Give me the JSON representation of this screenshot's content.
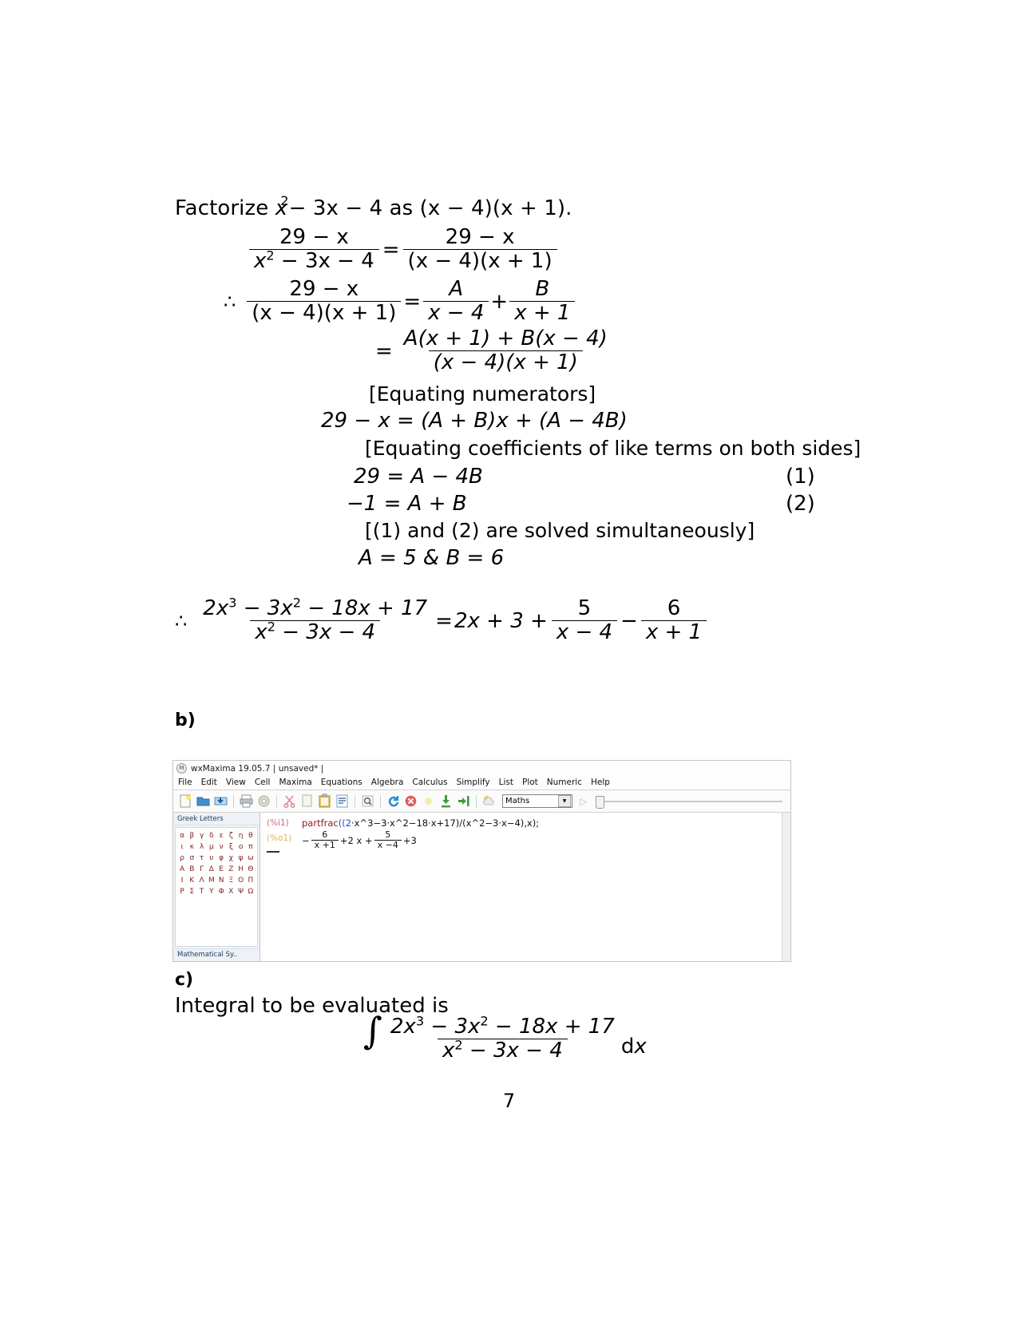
{
  "document": {
    "page_number": "7",
    "intro_line": {
      "prefix": "Factorize ",
      "expr_x": "x",
      "expr_sup": "2",
      "rest": "− 3x − 4 as (x − 4)(x + 1)."
    },
    "equations": {
      "eq1": {
        "lhs_num": "29 − x",
        "lhs_den_a": "x",
        "lhs_den_sup": "2",
        "lhs_den_b": " − 3x − 4",
        "rel": "=",
        "rhs_num": "29 − x",
        "rhs_den": "(x − 4)(x + 1)"
      },
      "eq2": {
        "therefore": "∴",
        "lhs_num": "29 − x",
        "lhs_den": "(x − 4)(x + 1)",
        "rel": "=",
        "t1_num": "A",
        "t1_den": "x − 4",
        "plus": "+",
        "t2_num": "B",
        "t2_den": "x + 1"
      },
      "eq3": {
        "rel": "=",
        "num": "A(x + 1) + B(x − 4)",
        "den": "(x − 4)(x + 1)"
      },
      "bracket1": "[Equating numerators]",
      "eq4": "29 − x = (A + B)x + (A − 4B)",
      "bracket2": "[Equating coefficients of like terms on both sides]",
      "eq5": "29 = A − 4B",
      "tag1": "(1)",
      "eq6": "−1 = A + B",
      "tag2": "(2)",
      "bracket3": "[(1) and (2) are solved simultaneously]",
      "eq7": "A = 5 & B = 6",
      "final": {
        "therefore": "∴",
        "num_a": "2x",
        "num_sup1": "3",
        "num_b": " − 3x",
        "num_sup2": "2",
        "num_c": " − 18x + 17",
        "den_a": "x",
        "den_sup": "2",
        "den_b": " − 3x − 4",
        "rel": "=",
        "poly": "2x + 3 +",
        "t1_num": "5",
        "t1_den": "x − 4",
        "minus": "−",
        "t2_num": "6",
        "t2_den": "x + 1"
      }
    },
    "part_b_label": "b)",
    "part_c_label": "c)",
    "part_c_intro": "Integral to be evaluated is",
    "integral": {
      "symbol": "∫",
      "num_a": "2x",
      "num_sup1": "3",
      "num_b": " − 3x",
      "num_sup2": "2",
      "num_c": " − 18x + 17",
      "den_a": "x",
      "den_sup": "2",
      "den_b": " − 3x − 4",
      "differential": "dx"
    }
  },
  "wxmaxima": {
    "title": "wxMaxima 19.05.7 | unsaved* |",
    "app_icon_glyph": "M",
    "menus": [
      {
        "label": "File"
      },
      {
        "label": "Edit"
      },
      {
        "label": "View"
      },
      {
        "label": "Cell"
      },
      {
        "label": "Maxima"
      },
      {
        "label": "Equations"
      },
      {
        "label": "Algebra"
      },
      {
        "label": "Calculus"
      },
      {
        "label": "Simplify"
      },
      {
        "label": "List"
      },
      {
        "label": "Plot"
      },
      {
        "label": "Numeric"
      },
      {
        "label": "Help"
      }
    ],
    "toolbar": {
      "buttons": [
        {
          "name": "new-document-icon",
          "color": "#f7f4d8"
        },
        {
          "name": "open-folder-icon",
          "color": "#3f8fd0"
        },
        {
          "name": "save-icon",
          "color": "#4a8fc0"
        },
        {
          "name": "print-icon",
          "color": "#9aa3ab"
        },
        {
          "name": "preferences-gear-icon",
          "color": "#c9c9b0"
        },
        {
          "name": "cut-scissors-icon",
          "color": "#e08a9a"
        },
        {
          "name": "copy-icon",
          "color": "#efefe4"
        },
        {
          "name": "paste-clipboard-icon",
          "color": "#e8c46a"
        },
        {
          "name": "select-all-icon",
          "color": "#7d9ec4"
        },
        {
          "name": "find-magnifier-icon",
          "color": "#cfd6dd"
        },
        {
          "name": "restart-maxima-icon",
          "color": "#4aa3df"
        },
        {
          "name": "interrupt-stop-icon",
          "color": "#e05a5a"
        },
        {
          "name": "evaluate-cell-icon",
          "color": "#f2e27a"
        },
        {
          "name": "evaluate-all-cells-icon",
          "color": "#3f9c3f"
        },
        {
          "name": "evaluate-until-here-icon",
          "color": "#3f9c3f"
        },
        {
          "name": "help-weather-icon",
          "color": "#e8d27a"
        }
      ],
      "style_select_value": "Maths",
      "style_dropdown_arrow": "▼",
      "play_button_glyph": "▷"
    },
    "sidebar": {
      "greek_header": "Greek Letters",
      "greek_rows": [
        [
          "α",
          "β",
          "γ",
          "δ",
          "ε",
          "ζ",
          "η",
          "θ"
        ],
        [
          "ι",
          "κ",
          "λ",
          "μ",
          "ν",
          "ξ",
          "ο",
          "π"
        ],
        [
          "ρ",
          "σ",
          "τ",
          "υ",
          "φ",
          "χ",
          "ψ",
          "ω"
        ],
        [
          "Α",
          "Β",
          "Γ",
          "Δ",
          "Ε",
          "Ζ",
          "Η",
          "Θ"
        ],
        [
          "Ι",
          "Κ",
          "Λ",
          "Μ",
          "Ν",
          "Ξ",
          "Ο",
          "Π"
        ],
        [
          "Ρ",
          "Σ",
          "Τ",
          "Υ",
          "Φ",
          "Χ",
          "Ψ",
          "Ω"
        ]
      ],
      "math_symbols_header": "Mathematical Sy.."
    },
    "worksheet": {
      "input_label": "(%i1)",
      "input_fn": "partfrac",
      "input_open": "((2",
      "input_code": "·x^3−3·x^2−18·x+17)/(x^2−3·x−4),x);",
      "output_label": "(%o1)",
      "output": {
        "minus": "−",
        "f1_num": "6",
        "f1_den": "x +1",
        "mid": "+2 x +",
        "f2_num": "5",
        "f2_den": "x −4",
        "tail": "+3"
      }
    }
  }
}
